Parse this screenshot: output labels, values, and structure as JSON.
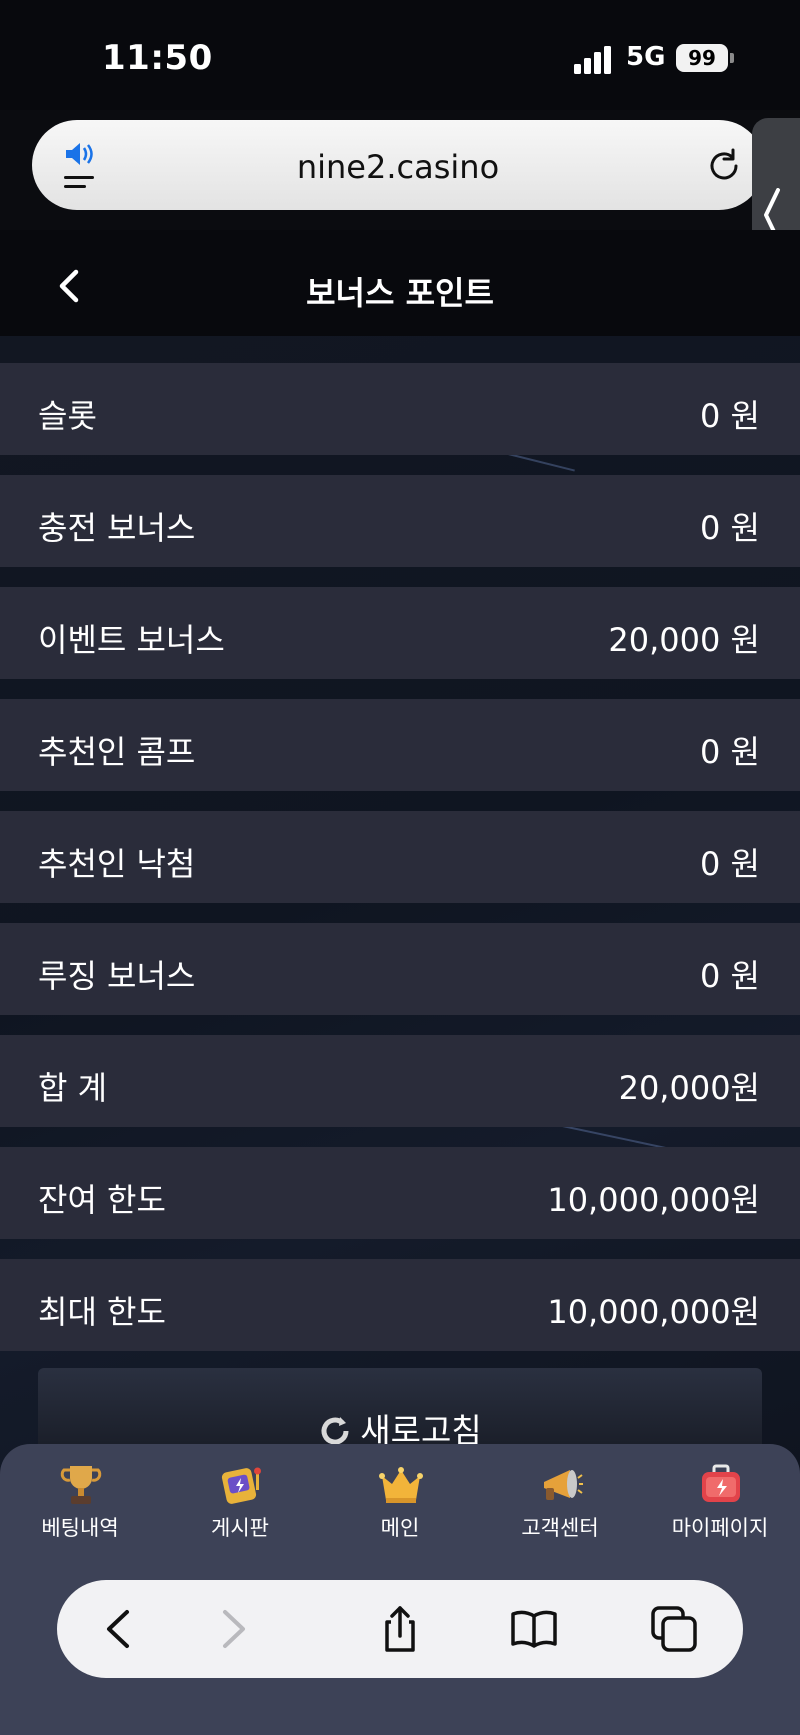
{
  "status_bar": {
    "time": "11:50",
    "network": "5G",
    "battery": "99"
  },
  "browser": {
    "url": "nine2.casino"
  },
  "header": {
    "title": "보너스 포인트"
  },
  "rows": [
    {
      "label": "슬롯",
      "value": "0 원"
    },
    {
      "label": "충전 보너스",
      "value": "0 원"
    },
    {
      "label": "이벤트 보너스",
      "value": "20,000 원"
    },
    {
      "label": "추천인 콤프",
      "value": "0 원"
    },
    {
      "label": "추천인 낙첨",
      "value": "0 원"
    },
    {
      "label": "루징 보너스",
      "value": "0 원"
    },
    {
      "label": "합 계",
      "value": "20,000원"
    },
    {
      "label": "잔여 한도",
      "value": "10,000,000원"
    },
    {
      "label": "최대 한도",
      "value": "10,000,000원"
    }
  ],
  "refresh": {
    "label": "새로고침"
  },
  "bottom_nav": [
    {
      "label": "베팅내역",
      "icon": "trophy-icon"
    },
    {
      "label": "게시판",
      "icon": "slot-machine-icon"
    },
    {
      "label": "메인",
      "icon": "crown-icon"
    },
    {
      "label": "고객센터",
      "icon": "megaphone-icon"
    },
    {
      "label": "마이페이지",
      "icon": "first-aid-kit-icon"
    }
  ]
}
